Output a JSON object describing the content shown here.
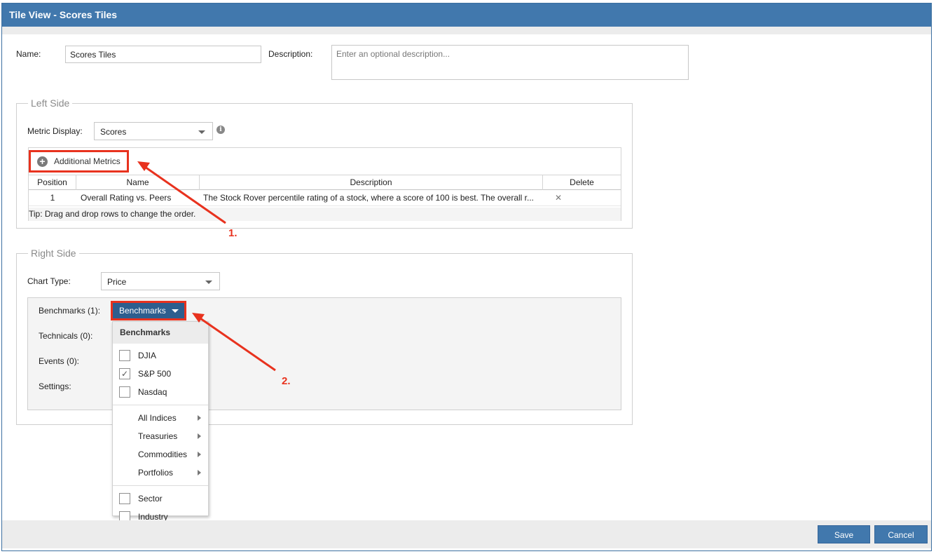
{
  "window": {
    "title": "Tile View - Scores Tiles"
  },
  "form": {
    "name_label": "Name:",
    "name_value": "Scores Tiles",
    "description_label": "Description:",
    "description_placeholder": "Enter an optional description..."
  },
  "left_side": {
    "legend": "Left Side",
    "metric_display_label": "Metric Display:",
    "metric_display_value": "Scores",
    "additional_metrics_label": "Additional Metrics",
    "grid": {
      "columns": [
        "Position",
        "Name",
        "Description",
        "Delete"
      ],
      "rows": [
        {
          "position": "1",
          "name": "Overall Rating vs. Peers",
          "description": "The Stock Rover percentile rating of a stock, where a score of 100 is best. The overall r..."
        }
      ]
    },
    "tip": "Tip: Drag and drop rows to change the order."
  },
  "right_side": {
    "legend": "Right Side",
    "chart_type_label": "Chart Type:",
    "chart_type_value": "Price",
    "benchmarks_label": "Benchmarks (1):",
    "benchmarks_button": "Benchmarks",
    "technicals_label": "Technicals (0):",
    "events_label": "Events (0):",
    "settings_label": "Settings:"
  },
  "benchmarks_menu": {
    "header": "Benchmarks",
    "checks": [
      {
        "label": "DJIA",
        "checked": false
      },
      {
        "label": "S&P 500",
        "checked": true
      },
      {
        "label": "Nasdaq",
        "checked": false
      }
    ],
    "submenus": [
      "All Indices",
      "Treasuries",
      "Commodities",
      "Portfolios"
    ],
    "checks2": [
      {
        "label": "Sector",
        "checked": false
      },
      {
        "label": "Industry",
        "checked": false
      }
    ]
  },
  "annotations": {
    "one": "1.",
    "two": "2."
  },
  "footer": {
    "save": "Save",
    "cancel": "Cancel"
  },
  "colors": {
    "title_bar": "#4178ad",
    "annotation": "#e8321e",
    "benchmarks_button": "#2d5e8e"
  }
}
